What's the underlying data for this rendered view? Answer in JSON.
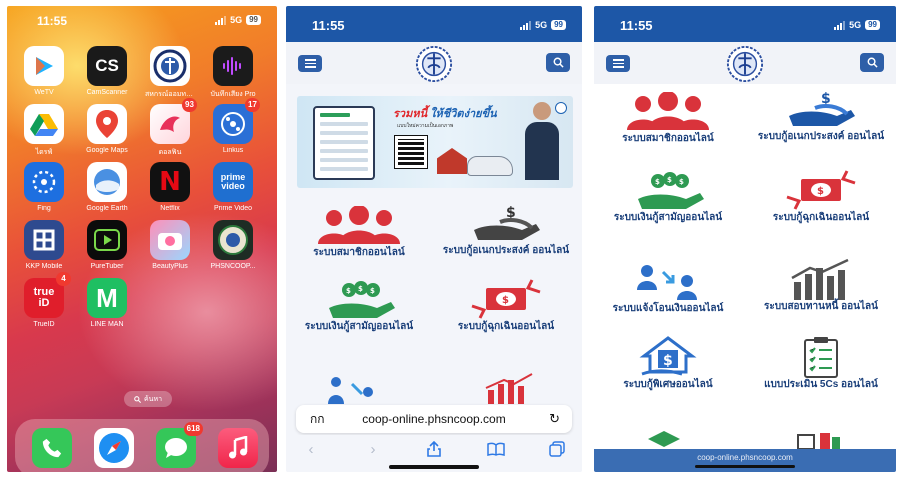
{
  "home": {
    "time": "11:55",
    "network": "5G",
    "battery": "99",
    "apps": [
      {
        "label": "WeTV"
      },
      {
        "label": "CamScanner",
        "glyph": "CS"
      },
      {
        "label": "สหกรณ์ออมทรัพ..."
      },
      {
        "label": "บันทึกเสียง Pro"
      },
      {
        "label": "ไดรฟ์"
      },
      {
        "label": "Google Maps"
      },
      {
        "label": "ดอลฟิน",
        "badge": "93"
      },
      {
        "label": "Linkus",
        "badge": "17"
      },
      {
        "label": "Fing"
      },
      {
        "label": "Google Earth"
      },
      {
        "label": "Netflix",
        "glyph": "N"
      },
      {
        "label": "Prime Video",
        "glyph": "prime video"
      },
      {
        "label": "KKP Mobile"
      },
      {
        "label": "PureTuber"
      },
      {
        "label": "BeautyPlus"
      },
      {
        "label": "PHSNCOOP..."
      },
      {
        "label": "TrueID",
        "badge": "4",
        "glyph": "true iD"
      },
      {
        "label": "LINE MAN",
        "glyph": "M"
      }
    ],
    "search_label": "ค้นหา",
    "dock": [
      {
        "label": "Phone"
      },
      {
        "label": "Safari"
      },
      {
        "label": "Messages",
        "badge": "618"
      },
      {
        "label": "Music"
      }
    ]
  },
  "browser": {
    "time": "11:55",
    "network": "5G",
    "battery": "99",
    "banner": {
      "headline": "รวมหนี้",
      "headline2": "ให้ชีวิตง่ายขึ้น",
      "subline": "แบบใหม่ความเป็นเอกภาพ"
    },
    "menu": [
      {
        "label": "ระบบสมาชิกออนไลน์"
      },
      {
        "label": "ระบบกู้อเนกประสงค์ ออนไลน์"
      },
      {
        "label": "ระบบเงินกู้สามัญออนไลน์"
      },
      {
        "label": "ระบบกู้ฉุกเฉินออนไลน์"
      }
    ],
    "address_aa": "กก",
    "address_url": "coop-online.phsncoop.com"
  },
  "browser2": {
    "time": "11:55",
    "network": "5G",
    "battery": "99",
    "menu": [
      {
        "label": "ระบบสมาชิกออนไลน์"
      },
      {
        "label": "ระบบกู้อเนกประสงค์ ออนไลน์"
      },
      {
        "label": "ระบบเงินกู้สามัญออนไลน์"
      },
      {
        "label": "ระบบกู้ฉุกเฉินออนไลน์"
      },
      {
        "label": "ระบบแจ้งโอนเงินออนไลน์"
      },
      {
        "label": "ระบบสอบทานหนี้ ออนไลน์"
      },
      {
        "label": "ระบบกู้พิเศษออนไลน์"
      },
      {
        "label": "แบบประเมิน 5Cs ออนไลน์"
      }
    ],
    "footer_url": "coop-online.phsncoop.com"
  },
  "colors": {
    "brand_blue": "#1d57a7",
    "people_red": "#d9333b",
    "money_green": "#2e9a52",
    "navy": "#1a3f7a"
  }
}
